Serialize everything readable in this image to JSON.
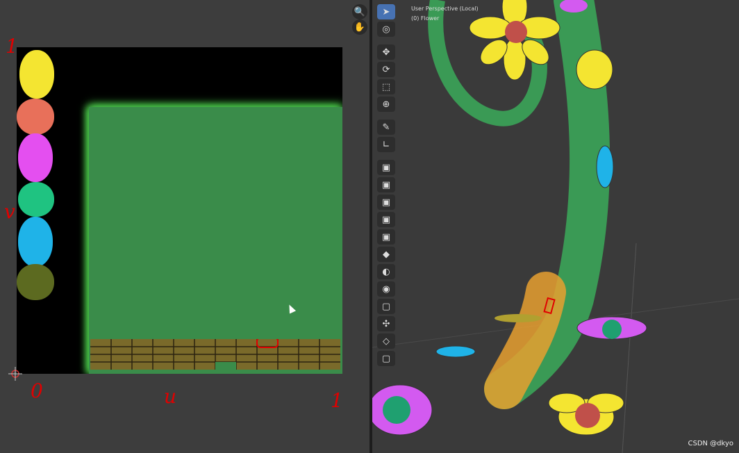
{
  "uv_editor": {
    "tools": {
      "zoom": "🔍",
      "pan": "✋"
    },
    "annotations": {
      "v_top": "1",
      "v_label": "v",
      "origin": "0",
      "u_label": "u",
      "u_end": "1"
    }
  },
  "viewport": {
    "perspective": "User Perspective (Local)",
    "object": "(0) Flower",
    "tools": [
      "➤",
      "◎",
      "✥",
      "⟳",
      "⬚",
      "⊕",
      "✎",
      "∟",
      "▣",
      "▣",
      "▣",
      "▣",
      "▣",
      "◆",
      "◐",
      "◉",
      "▢",
      "✣",
      "◇",
      "▢"
    ]
  },
  "watermark": "CSDN @dkyo",
  "colors": {
    "yellow": "#f4e531",
    "salmon": "#e8705a",
    "magenta": "#e44ff0",
    "teal": "#1fc381",
    "blue": "#1fb3e8",
    "olive": "#5c6a20",
    "island_green": "#3a8c4a",
    "stem_green": "#3a9a55",
    "selection_orange": "#e8a030"
  }
}
